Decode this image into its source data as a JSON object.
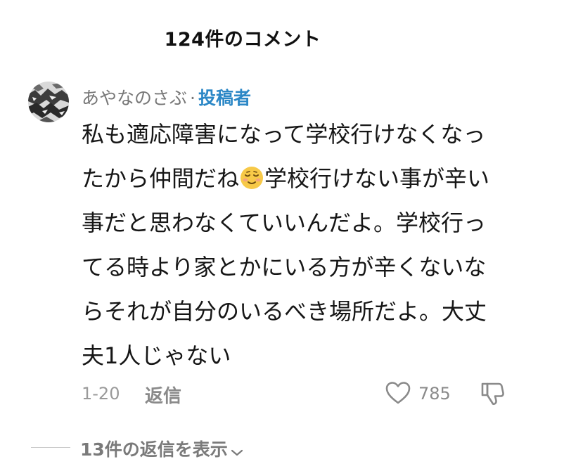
{
  "header": {
    "title": "124件のコメント"
  },
  "comment": {
    "author": "あやなのさぶ",
    "separator": "·",
    "badge": "投稿者",
    "text_lines": [
      "私も適応障害になって学校行けなくなっ",
      "たから仲間だね",
      "学校行けない事が辛い",
      "事だと思わなくていいんだよ。学校行っ",
      "てる時より家とかにいる方が辛くないな",
      "らそれが自分のいるべき場所だよ。大丈",
      "夫1人じゃない"
    ],
    "emoji": "relieved-face-emoji",
    "date": "1-20",
    "reply_label": "返信",
    "like_count": "785"
  },
  "replies": {
    "toggle_label": "13件の返信を表示"
  },
  "icons": {
    "like": "heart-outline-icon",
    "dislike": "thumbs-down-outline-icon",
    "expand": "chevron-down-icon"
  },
  "colors": {
    "badge": "#2b87c6",
    "muted": "#8a8a8a",
    "text": "#161616",
    "emoji": "#f7c948"
  }
}
